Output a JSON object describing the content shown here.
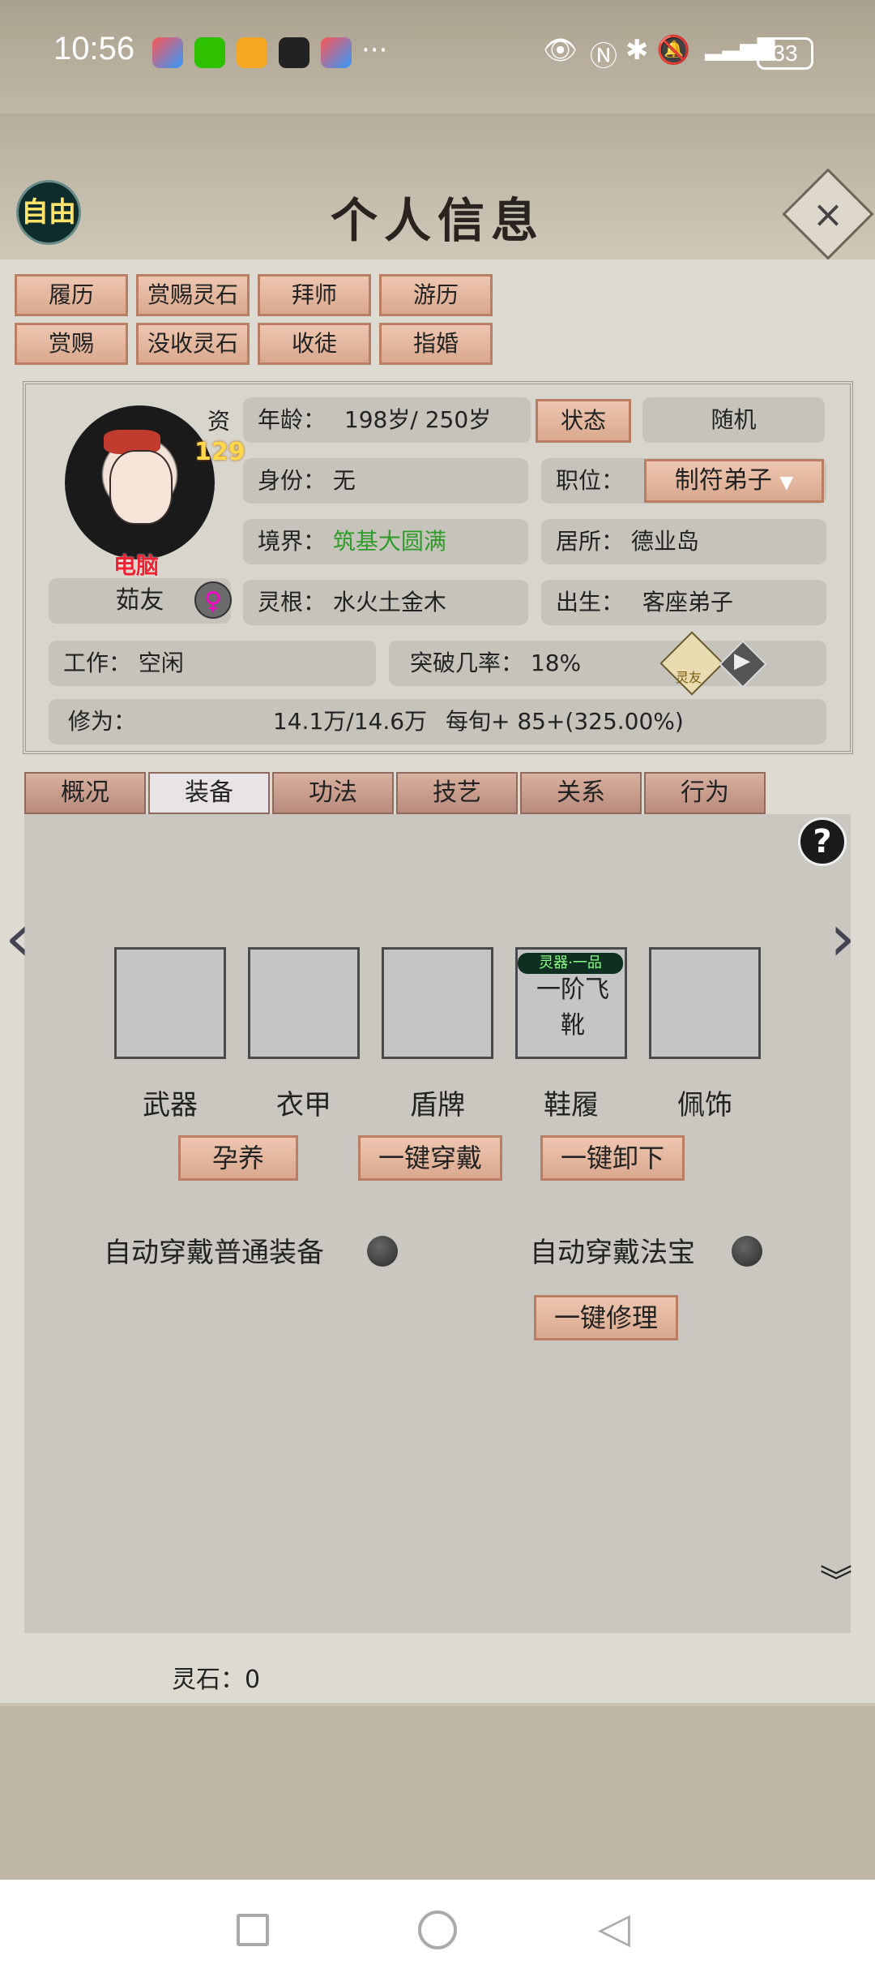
{
  "statusbar": {
    "time": "10:56",
    "more": "···",
    "battery": "33"
  },
  "header": {
    "title": "个人信息",
    "free_label": "自由",
    "close_label": "×"
  },
  "top_buttons": [
    "履历",
    "赏赐灵石",
    "拜师",
    "游历",
    "赏赐",
    "没收灵石",
    "收徒",
    "指婚"
  ],
  "character": {
    "zi": "资",
    "zi_value": "129",
    "badge": "电脑",
    "name": "茹友",
    "gender": "♀",
    "age_label": "年龄：",
    "age_value": "198岁/ 250岁",
    "status_btn": "状态",
    "random_label": "随机",
    "identity_label": "身份：",
    "identity_value": "无",
    "position_label": "职位：",
    "position_value": "制符弟子",
    "realm_label": "境界：",
    "realm_value": "筑基大圆满",
    "residence_label": "居所：",
    "residence_value": "德业岛",
    "root_label": "灵根：",
    "root_value": "水火土金木",
    "birth_label": "出生：",
    "birth_value": "客座弟子",
    "work_label": "工作：",
    "work_value": "空闲",
    "breakthrough_label": "突破几率：",
    "breakthrough_value": "18%",
    "friend_icon_text": "灵友",
    "cultivation_label": "修为：",
    "cultivation_value": "14.1万/14.6万",
    "per_turn": "每旬+  85+(325.00%)"
  },
  "tabs": [
    "概况",
    "装备",
    "功法",
    "技艺",
    "关系",
    "行为"
  ],
  "active_tab": 1,
  "equipment": {
    "slots": [
      {
        "label": "武器",
        "item": ""
      },
      {
        "label": "衣甲",
        "item": ""
      },
      {
        "label": "盾牌",
        "item": ""
      },
      {
        "label": "鞋履",
        "item": "一阶飞靴",
        "grade": "灵器·一品"
      },
      {
        "label": "佩饰",
        "item": ""
      }
    ],
    "nurture": "孕养",
    "equip_all": "一键穿戴",
    "unequip_all": "一键卸下",
    "auto_normal": "自动穿戴普通装备",
    "auto_treasure": "自动穿戴法宝",
    "repair_all": "一键修理"
  },
  "footer": {
    "spirit_stone": "灵石：0"
  },
  "colors": {
    "accent_button": "#e2b49c",
    "tab": "#c59c8e",
    "green": "#2e9b2b",
    "panel": "#dddad1"
  }
}
